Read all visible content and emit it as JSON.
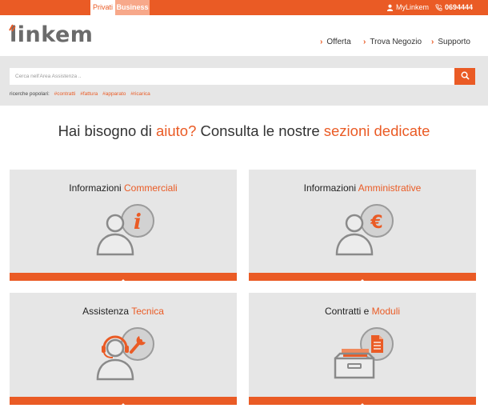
{
  "topbar": {
    "tabs": [
      {
        "label": "Privati"
      },
      {
        "label": "Business"
      }
    ],
    "account_label": "MyLinkem",
    "phone": "0694444",
    "colors": {
      "accent": "#ea5b25",
      "business_tab": "#f7a88a"
    }
  },
  "header": {
    "logo_text": "linkem",
    "nav": [
      {
        "label": "Offerta"
      },
      {
        "label": "Trova Negozio"
      },
      {
        "label": "Supporto"
      }
    ]
  },
  "search": {
    "placeholder": "Cerca nell'Area Assistenza ..",
    "popular_label": "ricerche popolari:",
    "popular_tags": [
      "#contratti",
      "#fattura",
      "#apparato",
      "#ricarica"
    ]
  },
  "headline": {
    "part1": "Hai bisogno di ",
    "accent1": "aiuto?",
    "part2": " Consulta le nostre ",
    "accent2": "sezioni dedicate"
  },
  "cards": [
    {
      "title_plain": "Informazioni ",
      "title_accent": "Commerciali",
      "icon": "info-person-icon"
    },
    {
      "title_plain": "Informazioni ",
      "title_accent": "Amministrative",
      "icon": "euro-person-icon"
    },
    {
      "title_plain": "Assistenza ",
      "title_accent": "Tecnica",
      "icon": "headset-wrench-icon"
    },
    {
      "title_plain": "Contratti e ",
      "title_accent": "Moduli",
      "icon": "file-drawer-icon"
    }
  ]
}
